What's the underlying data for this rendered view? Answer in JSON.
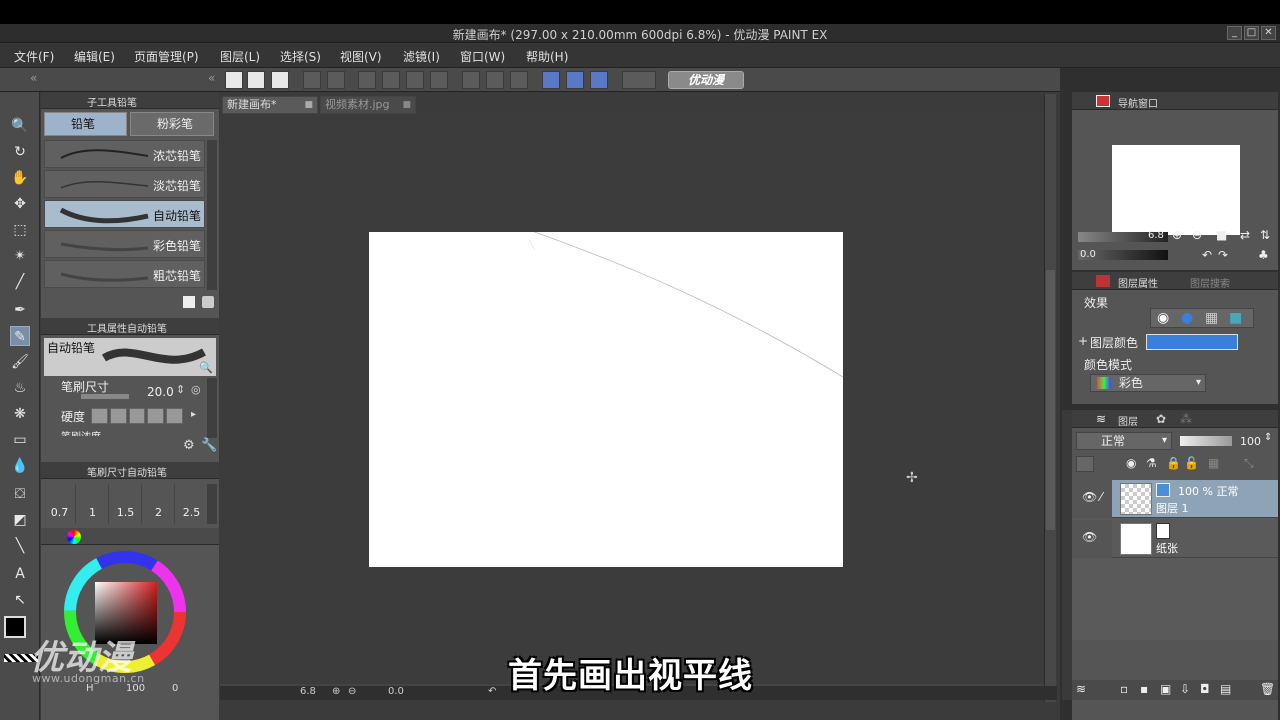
{
  "window": {
    "title": "新建画布* (297.00 x 210.00mm 600dpi 6.8%)  - 优动漫 PAINT EX",
    "buttons": [
      "_",
      "□",
      "✕"
    ]
  },
  "menu": [
    "文件(F)",
    "编辑(E)",
    "页面管理(P)",
    "图层(L)",
    "选择(S)",
    "视图(V)",
    "滤镜(I)",
    "窗口(W)",
    "帮助(H)"
  ],
  "toolbar": {
    "logo_text": "优动漫"
  },
  "doc_tabs": [
    "新建画布*",
    "视频素材.jpg"
  ],
  "subtool_panel": {
    "header": "子工具铅笔",
    "tabs": [
      "铅笔",
      "粉彩笔"
    ],
    "brushes": [
      "浓芯铅笔",
      "淡芯铅笔",
      "自动铅笔",
      "彩色铅笔",
      "粗芯铅笔"
    ],
    "selected_brush": "自动铅笔"
  },
  "tool_property": {
    "header": "工具属性自动铅笔",
    "preview_label": "自动铅笔",
    "brush_size_label": "笔刷尺寸",
    "brush_size_value": "20.0",
    "hardness_label": "硬度",
    "density_label": "笔刷浓度"
  },
  "brush_size_panel": {
    "header": "笔刷尺寸自动铅笔",
    "sizes": [
      "0.7",
      "1",
      "1.5",
      "2",
      "2.5"
    ]
  },
  "color": {
    "foreground": "#000000",
    "background": "#ffffff",
    "accent": "#3a7fd8"
  },
  "bottom_status": {
    "zoom": "6.8",
    "angle": "0.0",
    "left_zoom": "100",
    "left_angle": "0"
  },
  "navigator": {
    "header": "导航窗口",
    "zoom": "6.8",
    "angle": "0.0"
  },
  "layer_property": {
    "tab_active": "图层属性",
    "tab_inactive": "图层搜索",
    "effect_label": "效果",
    "layer_color_label": "图层颜色",
    "color_mode_label": "颜色模式",
    "color_mode_value": "彩色"
  },
  "layers_panel": {
    "tab": "图层",
    "blend_mode": "正常",
    "opacity": "100",
    "layers": [
      {
        "meta": "100 % 正常",
        "name": "图层 1",
        "selected": true
      },
      {
        "meta": "",
        "name": "纸张",
        "selected": false
      }
    ]
  },
  "subtitle": "首先画出视平线",
  "watermark": {
    "brand": "优动漫",
    "url": "www.udongman.cn"
  }
}
